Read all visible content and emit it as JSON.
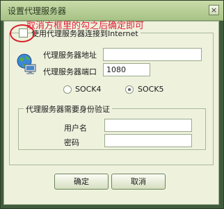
{
  "window": {
    "title": "设置代理服务器",
    "close_glyph": "×"
  },
  "annotation": {
    "text": "取消方框里的勾之后确定即可",
    "color": "#e0203a"
  },
  "proxy": {
    "use_proxy_label": "使用代理服务器连接到Internet",
    "use_proxy_checked": false,
    "address_label": "代理服务器地址",
    "address_value": "",
    "port_label": "代理服务器端口",
    "port_value": "1080",
    "sock4_label": "SOCK4",
    "sock5_label": "SOCK5",
    "selected": "SOCK5"
  },
  "auth": {
    "group_label": "代理服务器需要身份验证",
    "username_label": "用户名",
    "username_value": "",
    "password_label": "密码",
    "password_value": ""
  },
  "buttons": {
    "ok": "确定",
    "cancel": "取消"
  },
  "icons": {
    "network": "network-globe-computer-icon"
  }
}
